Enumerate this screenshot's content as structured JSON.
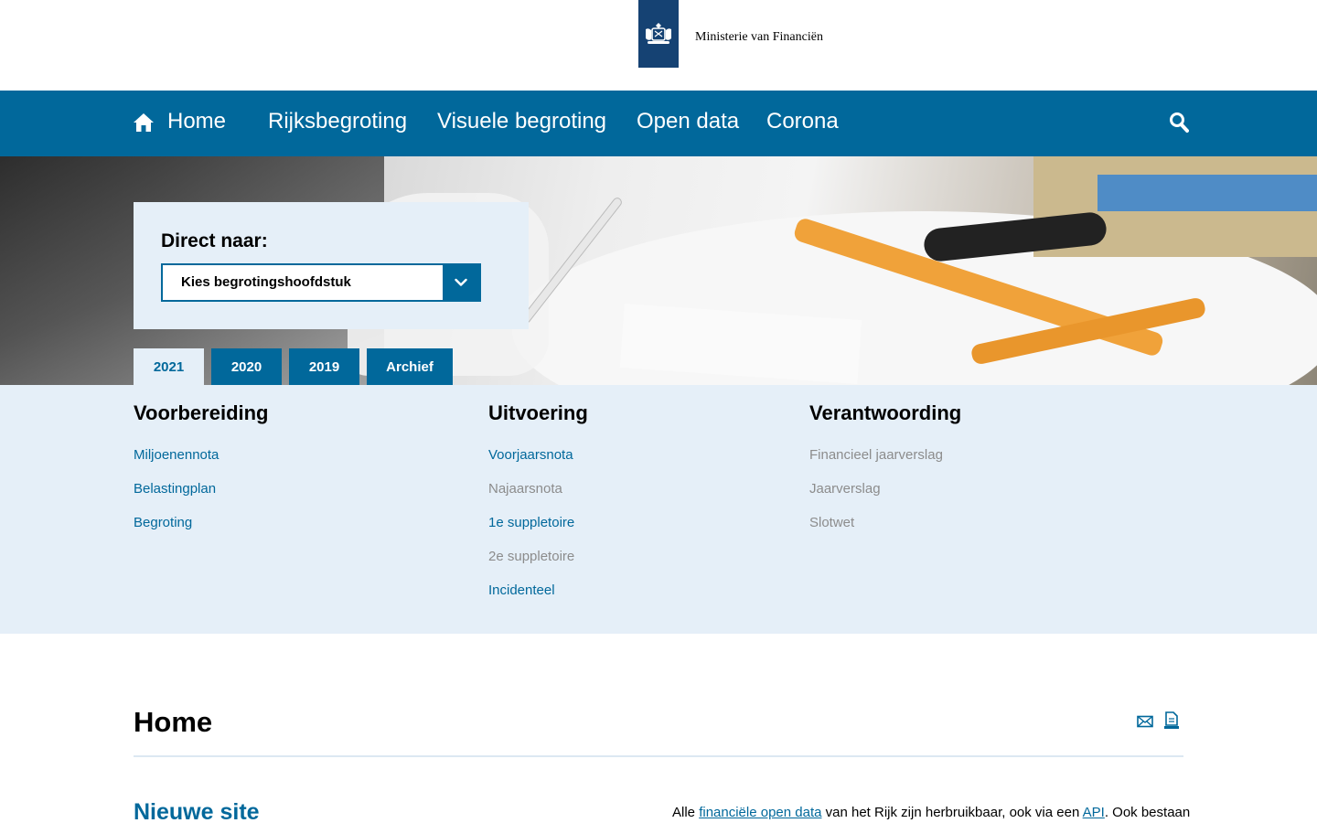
{
  "header": {
    "ministry_name": "Ministerie van Financiën"
  },
  "nav": {
    "items": [
      {
        "label": "Home"
      },
      {
        "label": "Rijksbegroting"
      },
      {
        "label": "Visuele begroting"
      },
      {
        "label": "Open data"
      },
      {
        "label": "Corona"
      }
    ]
  },
  "direct": {
    "label": "Direct naar:",
    "select_value": "Kies begrotingshoofdstuk"
  },
  "year_tabs": [
    {
      "label": "2021",
      "active": true
    },
    {
      "label": "2020",
      "active": false
    },
    {
      "label": "2019",
      "active": false
    },
    {
      "label": "Archief",
      "active": false
    }
  ],
  "columns": [
    {
      "heading": "Voorbereiding",
      "links": [
        {
          "label": "Miljoenennota",
          "enabled": true
        },
        {
          "label": "Belastingplan",
          "enabled": true
        },
        {
          "label": "Begroting",
          "enabled": true
        }
      ]
    },
    {
      "heading": "Uitvoering",
      "links": [
        {
          "label": "Voorjaarsnota",
          "enabled": true
        },
        {
          "label": "Najaarsnota",
          "enabled": false
        },
        {
          "label": "1e suppletoire",
          "enabled": true
        },
        {
          "label": "2e suppletoire",
          "enabled": false
        },
        {
          "label": "Incidenteel",
          "enabled": true
        }
      ]
    },
    {
      "heading": "Verantwoording",
      "links": [
        {
          "label": "Financieel jaarverslag",
          "enabled": false
        },
        {
          "label": "Jaarverslag",
          "enabled": false
        },
        {
          "label": "Slotwet",
          "enabled": false
        }
      ]
    }
  ],
  "main": {
    "title": "Home",
    "section_title": "Nieuwe site",
    "text_prefix": "Alle ",
    "link1": "financiële open data",
    "text_middle": " van het Rijk zijn herbruikbaar, ook via een ",
    "link2": "API",
    "text_suffix": ". Ook bestaan"
  },
  "colors": {
    "nav_blue": "#01689b",
    "logo_blue": "#154273",
    "light_panel": "#e5eff8",
    "disabled_text": "#8c8c8c"
  },
  "icons": [
    "home-icon",
    "search-icon",
    "chevron-down-icon",
    "mail-icon",
    "print-icon",
    "coat-of-arms-icon"
  ]
}
